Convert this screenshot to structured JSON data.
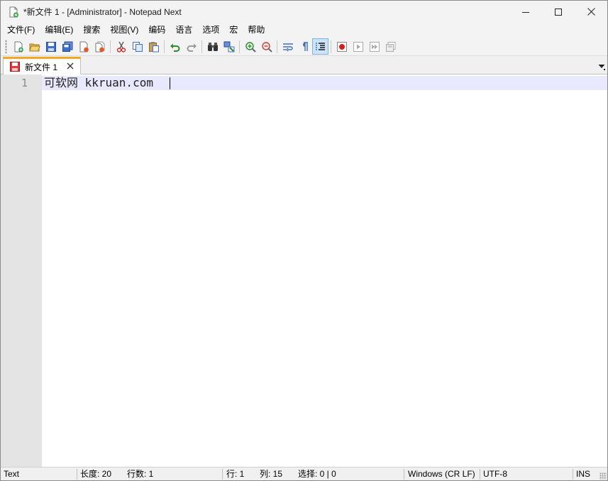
{
  "window": {
    "title": "*新文件 1 - [Administrator] - Notepad Next"
  },
  "menu": {
    "items": [
      "文件(F)",
      "编辑(E)",
      "搜索",
      "视图(V)",
      "编码",
      "语言",
      "选项",
      "宏",
      "帮助"
    ]
  },
  "toolbar": {
    "icons": [
      "new-file-icon",
      "open-file-icon",
      "save-icon",
      "save-all-icon",
      "close-file-icon",
      "close-all-icon",
      "cut-icon",
      "copy-icon",
      "paste-icon",
      "undo-icon",
      "redo-icon",
      "find-icon",
      "replace-icon",
      "zoom-in-icon",
      "zoom-out-icon",
      "word-wrap-icon",
      "show-all-characters-icon",
      "indent-guide-icon",
      "record-macro-icon",
      "play-macro-icon",
      "run-macro-multiple-icon",
      "save-macro-icon"
    ],
    "active": "indent-guide-icon"
  },
  "tabs": [
    {
      "label": "新文件 1",
      "modified": true
    }
  ],
  "editor": {
    "lines": [
      {
        "number": "1",
        "text": "可软网 kkruan.com"
      }
    ]
  },
  "status": {
    "language": "Text",
    "length": "长度: 20",
    "lines": "行数: 1",
    "line": "行: 1",
    "col": "列: 15",
    "selection": "选择: 0 | 0",
    "eol": "Windows (CR LF)",
    "encoding": "UTF-8",
    "mode": "INS"
  },
  "colors": {
    "tab_accent": "#f5a623",
    "current_line": "#e8e8ff",
    "gutter": "#e4e4e4",
    "active_button": "#cce4f7"
  }
}
